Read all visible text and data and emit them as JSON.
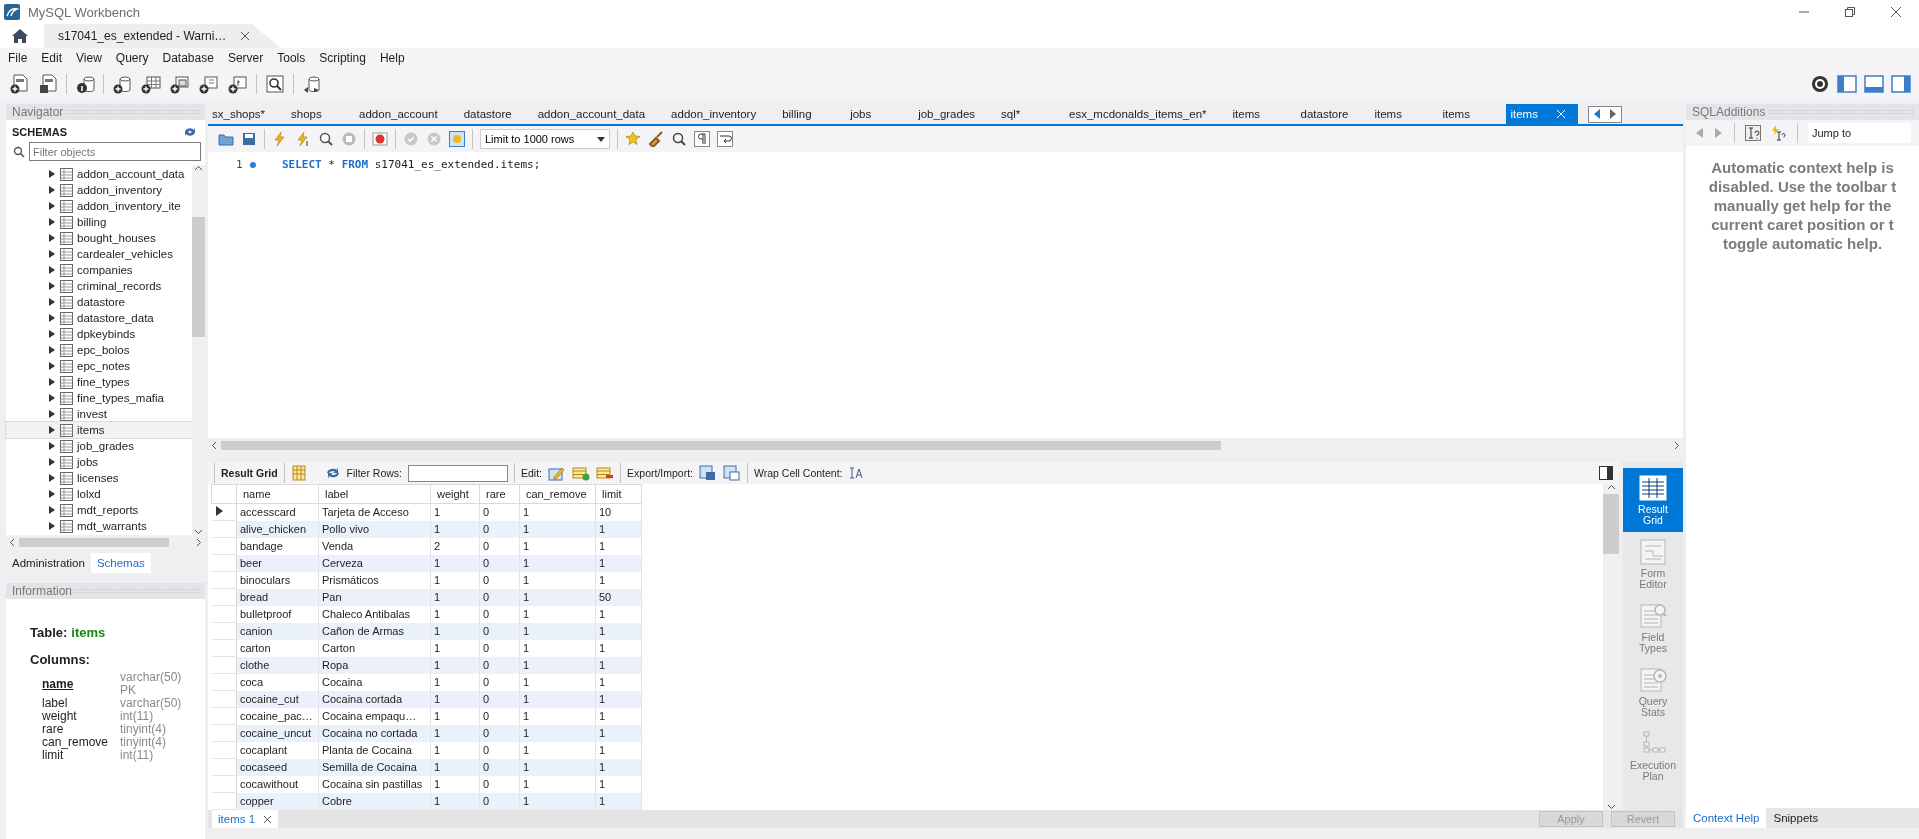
{
  "window": {
    "title": "MySQL Workbench"
  },
  "connection_tab": {
    "label": "s17041_es_extended - Warni…"
  },
  "menu": [
    "File",
    "Edit",
    "View",
    "Query",
    "Database",
    "Server",
    "Tools",
    "Scripting",
    "Help"
  ],
  "navigator": {
    "title": "Navigator",
    "schemas_title": "SCHEMAS",
    "filter": {
      "placeholder": "Filter objects"
    },
    "tables": [
      {
        "name": "addon_account_data",
        "selected": false
      },
      {
        "name": "addon_inventory",
        "selected": false
      },
      {
        "name": "addon_inventory_ite",
        "selected": false
      },
      {
        "name": "billing",
        "selected": false
      },
      {
        "name": "bought_houses",
        "selected": false
      },
      {
        "name": "cardealer_vehicles",
        "selected": false
      },
      {
        "name": "companies",
        "selected": false
      },
      {
        "name": "criminal_records",
        "selected": false
      },
      {
        "name": "datastore",
        "selected": false
      },
      {
        "name": "datastore_data",
        "selected": false
      },
      {
        "name": "dpkeybinds",
        "selected": false
      },
      {
        "name": "epc_bolos",
        "selected": false
      },
      {
        "name": "epc_notes",
        "selected": false
      },
      {
        "name": "fine_types",
        "selected": false
      },
      {
        "name": "fine_types_mafia",
        "selected": false
      },
      {
        "name": "invest",
        "selected": false
      },
      {
        "name": "items",
        "selected": true
      },
      {
        "name": "job_grades",
        "selected": false
      },
      {
        "name": "jobs",
        "selected": false
      },
      {
        "name": "licenses",
        "selected": false
      },
      {
        "name": "lolxd",
        "selected": false
      },
      {
        "name": "mdt_reports",
        "selected": false
      },
      {
        "name": "mdt_warrants",
        "selected": false
      }
    ],
    "tabs": [
      {
        "label": "Administration",
        "selected": false
      },
      {
        "label": "Schemas",
        "selected": true
      }
    ]
  },
  "information": {
    "title": "Information",
    "table_label": "Table:",
    "table_name": "items",
    "columns_label": "Columns:",
    "columns": [
      {
        "name": "name",
        "type": "varchar(50)",
        "key": "PK",
        "primary": true
      },
      {
        "name": "label",
        "type": "varchar(50)",
        "primary": false
      },
      {
        "name": "weight",
        "type": "int(11)",
        "primary": false
      },
      {
        "name": "rare",
        "type": "tinyint(4)",
        "primary": false
      },
      {
        "name": "can_remove",
        "type": "tinyint(4)",
        "primary": false
      },
      {
        "name": "limit",
        "type": "int(11)",
        "primary": false
      }
    ]
  },
  "query_tabs": [
    {
      "label": "sx_shops*",
      "selected": false
    },
    {
      "label": "shops",
      "selected": false
    },
    {
      "label": "addon_account",
      "selected": false
    },
    {
      "label": "datastore",
      "selected": false
    },
    {
      "label": "addon_account_data",
      "selected": false
    },
    {
      "label": "addon_inventory",
      "selected": false
    },
    {
      "label": "billing",
      "selected": false
    },
    {
      "label": "jobs",
      "selected": false
    },
    {
      "label": "job_grades",
      "selected": false
    },
    {
      "label": "sql*",
      "selected": false
    },
    {
      "label": "esx_mcdonalds_items_en*",
      "selected": false
    },
    {
      "label": "items",
      "selected": false
    },
    {
      "label": "datastore",
      "selected": false
    },
    {
      "label": "items",
      "selected": false
    },
    {
      "label": "items",
      "selected": false
    },
    {
      "label": "items",
      "selected": true
    }
  ],
  "editor": {
    "limit": "Limit to 1000 rows",
    "lines": [
      {
        "number": "1",
        "tokens": [
          {
            "text": "SELECT",
            "kind": "keyword"
          },
          {
            "text": " * ",
            "kind": "plain"
          },
          {
            "text": "FROM",
            "kind": "keyword"
          },
          {
            "text": " s17041_es_extended.items;",
            "kind": "plain"
          }
        ]
      }
    ]
  },
  "result": {
    "toolbar": {
      "result_grid": "Result Grid",
      "filter_rows": "Filter Rows:",
      "edit": "Edit:",
      "export_import": "Export/Import:",
      "wrap": "Wrap Cell Content:"
    },
    "columns": [
      "name",
      "label",
      "weight",
      "rare",
      "can_remove",
      "limit"
    ],
    "rows": [
      {
        "current": true,
        "cells": [
          "accesscard",
          "Tarjeta de Acceso",
          "1",
          "0",
          "1",
          "10"
        ]
      },
      {
        "current": false,
        "cells": [
          "alive_chicken",
          "Pollo vivo",
          "1",
          "0",
          "1",
          "1"
        ]
      },
      {
        "current": false,
        "cells": [
          "bandage",
          "Venda",
          "2",
          "0",
          "1",
          "1"
        ]
      },
      {
        "current": false,
        "cells": [
          "beer",
          "Cerveza",
          "1",
          "0",
          "1",
          "1"
        ]
      },
      {
        "current": false,
        "cells": [
          "binoculars",
          "Prismáticos",
          "1",
          "0",
          "1",
          "1"
        ]
      },
      {
        "current": false,
        "cells": [
          "bread",
          "Pan",
          "1",
          "0",
          "1",
          "50"
        ]
      },
      {
        "current": false,
        "cells": [
          "bulletproof",
          "Chaleco Antibalas",
          "1",
          "0",
          "1",
          "1"
        ]
      },
      {
        "current": false,
        "cells": [
          "canion",
          "Cañon de Armas",
          "1",
          "0",
          "1",
          "1"
        ]
      },
      {
        "current": false,
        "cells": [
          "carton",
          "Carton",
          "1",
          "0",
          "1",
          "1"
        ]
      },
      {
        "current": false,
        "cells": [
          "clothe",
          "Ropa",
          "1",
          "0",
          "1",
          "1"
        ]
      },
      {
        "current": false,
        "cells": [
          "coca",
          "Cocaina",
          "1",
          "0",
          "1",
          "1"
        ]
      },
      {
        "current": false,
        "cells": [
          "cocaine_cut",
          "Cocaina cortada",
          "1",
          "0",
          "1",
          "1"
        ]
      },
      {
        "current": false,
        "cells": [
          "cocaine_pac…",
          "Cocaina empaqu…",
          "1",
          "0",
          "1",
          "1"
        ]
      },
      {
        "current": false,
        "cells": [
          "cocaine_uncut",
          "Cocaina no cortada",
          "1",
          "0",
          "1",
          "1"
        ]
      },
      {
        "current": false,
        "cells": [
          "cocaplant",
          "Planta de Cocaina",
          "1",
          "0",
          "1",
          "1"
        ]
      },
      {
        "current": false,
        "cells": [
          "cocaseed",
          "Semilla de Cocaina",
          "1",
          "0",
          "1",
          "1"
        ]
      },
      {
        "current": false,
        "cells": [
          "cocawithout",
          "Cocaina sin pastillas",
          "1",
          "0",
          "1",
          "1"
        ]
      },
      {
        "current": false,
        "cells": [
          "copper",
          "Cobre",
          "1",
          "0",
          "1",
          "1"
        ]
      }
    ],
    "side_buttons": [
      {
        "label": "Result Grid",
        "kind": "grid",
        "selected": true
      },
      {
        "label": "Form Editor",
        "kind": "form",
        "selected": false
      },
      {
        "label": "Field Types",
        "kind": "fields",
        "selected": false
      },
      {
        "label": "Query Stats",
        "kind": "stats",
        "selected": false
      },
      {
        "label": "Execution Plan",
        "kind": "plan",
        "selected": false
      }
    ],
    "tabs": [
      {
        "label": "items 1",
        "selected": true
      }
    ],
    "buttons": [
      {
        "label": "Apply",
        "disabled": true
      },
      {
        "label": "Revert",
        "disabled": true
      }
    ]
  },
  "sql_additions": {
    "title": "SQLAdditions",
    "jump_to": "Jump to",
    "help_lines": [
      "Automatic context help is",
      "disabled. Use the toolbar t",
      "manually get help for the",
      "current caret position or t",
      "toggle automatic help."
    ],
    "tabs": [
      {
        "label": "Context Help",
        "selected": true
      },
      {
        "label": "Snippets",
        "selected": false
      }
    ]
  }
}
